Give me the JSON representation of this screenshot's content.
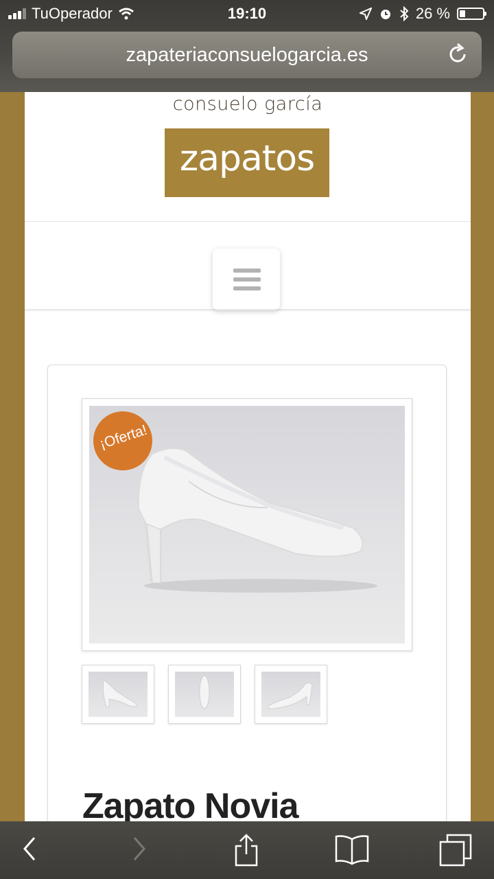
{
  "status_bar": {
    "carrier": "TuOperador",
    "time": "19:10",
    "battery_percent": "26 %",
    "icons": [
      "signal-icon",
      "wifi-icon",
      "location-icon",
      "alarm-icon",
      "bluetooth-icon",
      "battery-icon"
    ]
  },
  "address_bar": {
    "url": "zapateriaconsuelogarcia.es",
    "reload_icon": "reload-icon"
  },
  "site": {
    "brand_small": "consuelo garcía",
    "logo_text": "zapatos",
    "menu_icon": "hamburger-menu-icon"
  },
  "product": {
    "badge": "¡Oferta!",
    "title": "Zapato Novia",
    "thumbnail_count": 3
  },
  "toolbar": {
    "icons": [
      "back-icon",
      "forward-icon",
      "share-icon",
      "bookmarks-icon",
      "tabs-icon"
    ]
  },
  "colors": {
    "brand_gold": "#a6843a",
    "offer_badge": "#d6782a",
    "page_background": "#9b7c3a"
  }
}
